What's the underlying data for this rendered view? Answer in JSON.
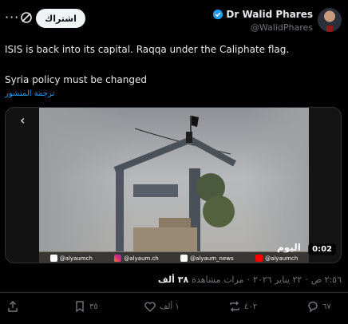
{
  "header": {
    "subscribe_label": "اشتراك",
    "author_name": "Dr Walid Phares",
    "handle": "@WalidPhares"
  },
  "tweet": {
    "line1": "ISIS is back into its capital. Raqqa under the Caliphate flag.",
    "line2": "Syria policy must be changed",
    "translate_label": "ترجمة المنشور"
  },
  "media": {
    "duration": "0:02",
    "brand": "اليوم",
    "socials": [
      "@alyaumch",
      "@alyaum.ch",
      "@alyaum_news",
      "@alyaumch"
    ]
  },
  "meta": {
    "time": "٢:٥٦ ص",
    "date": "٢٢ يناير ٢٠٢٦",
    "views_label": "مرات مشاهدة",
    "views_count": "٣٨ ألف"
  },
  "actions": {
    "replies": "٦٧",
    "reposts": "٤٠٢",
    "likes": "١ ألف",
    "bookmarks": "٣٥"
  },
  "colors": {
    "background": "#000000",
    "accent": "#1d9bf0",
    "muted": "#71767b",
    "text": "#e7e9ea"
  },
  "icons": [
    "more-icon",
    "grok-icon",
    "verified-badge-icon",
    "chevron-left-icon",
    "upload-icon",
    "bookmark-icon",
    "heart-icon",
    "repost-icon",
    "reply-icon",
    "facebook-icon",
    "instagram-icon",
    "x-icon",
    "youtube-icon"
  ]
}
